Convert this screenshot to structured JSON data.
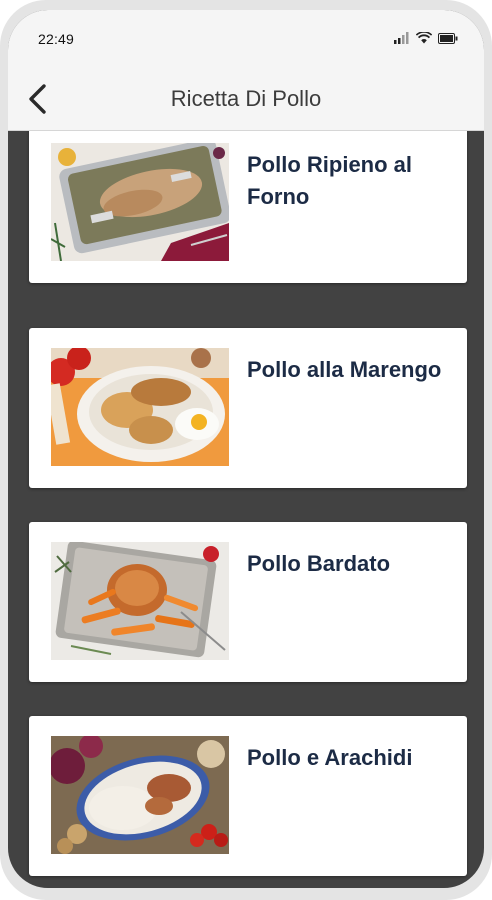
{
  "status_bar": {
    "time": "22:49",
    "icons": [
      "signal-icon",
      "wifi-icon",
      "battery-icon"
    ]
  },
  "app_bar": {
    "title": "Ricetta Di Pollo",
    "back_icon": "chevron-left-icon"
  },
  "recipes": [
    {
      "title": "Pollo Ripieno al Forno",
      "image": "roasted-stuffed-chicken-tray"
    },
    {
      "title": "Pollo alla Marengo",
      "image": "chicken-with-egg-plate"
    },
    {
      "title": "Pollo Bardato",
      "image": "bard-chicken-carrots-tray"
    },
    {
      "title": "Pollo e Arachidi",
      "image": "chicken-rice-peanuts-plate"
    }
  ],
  "colors": {
    "background": "#424242",
    "card": "#ffffff",
    "title_text": "#1c2b45",
    "bar": "#f5f5f5"
  }
}
